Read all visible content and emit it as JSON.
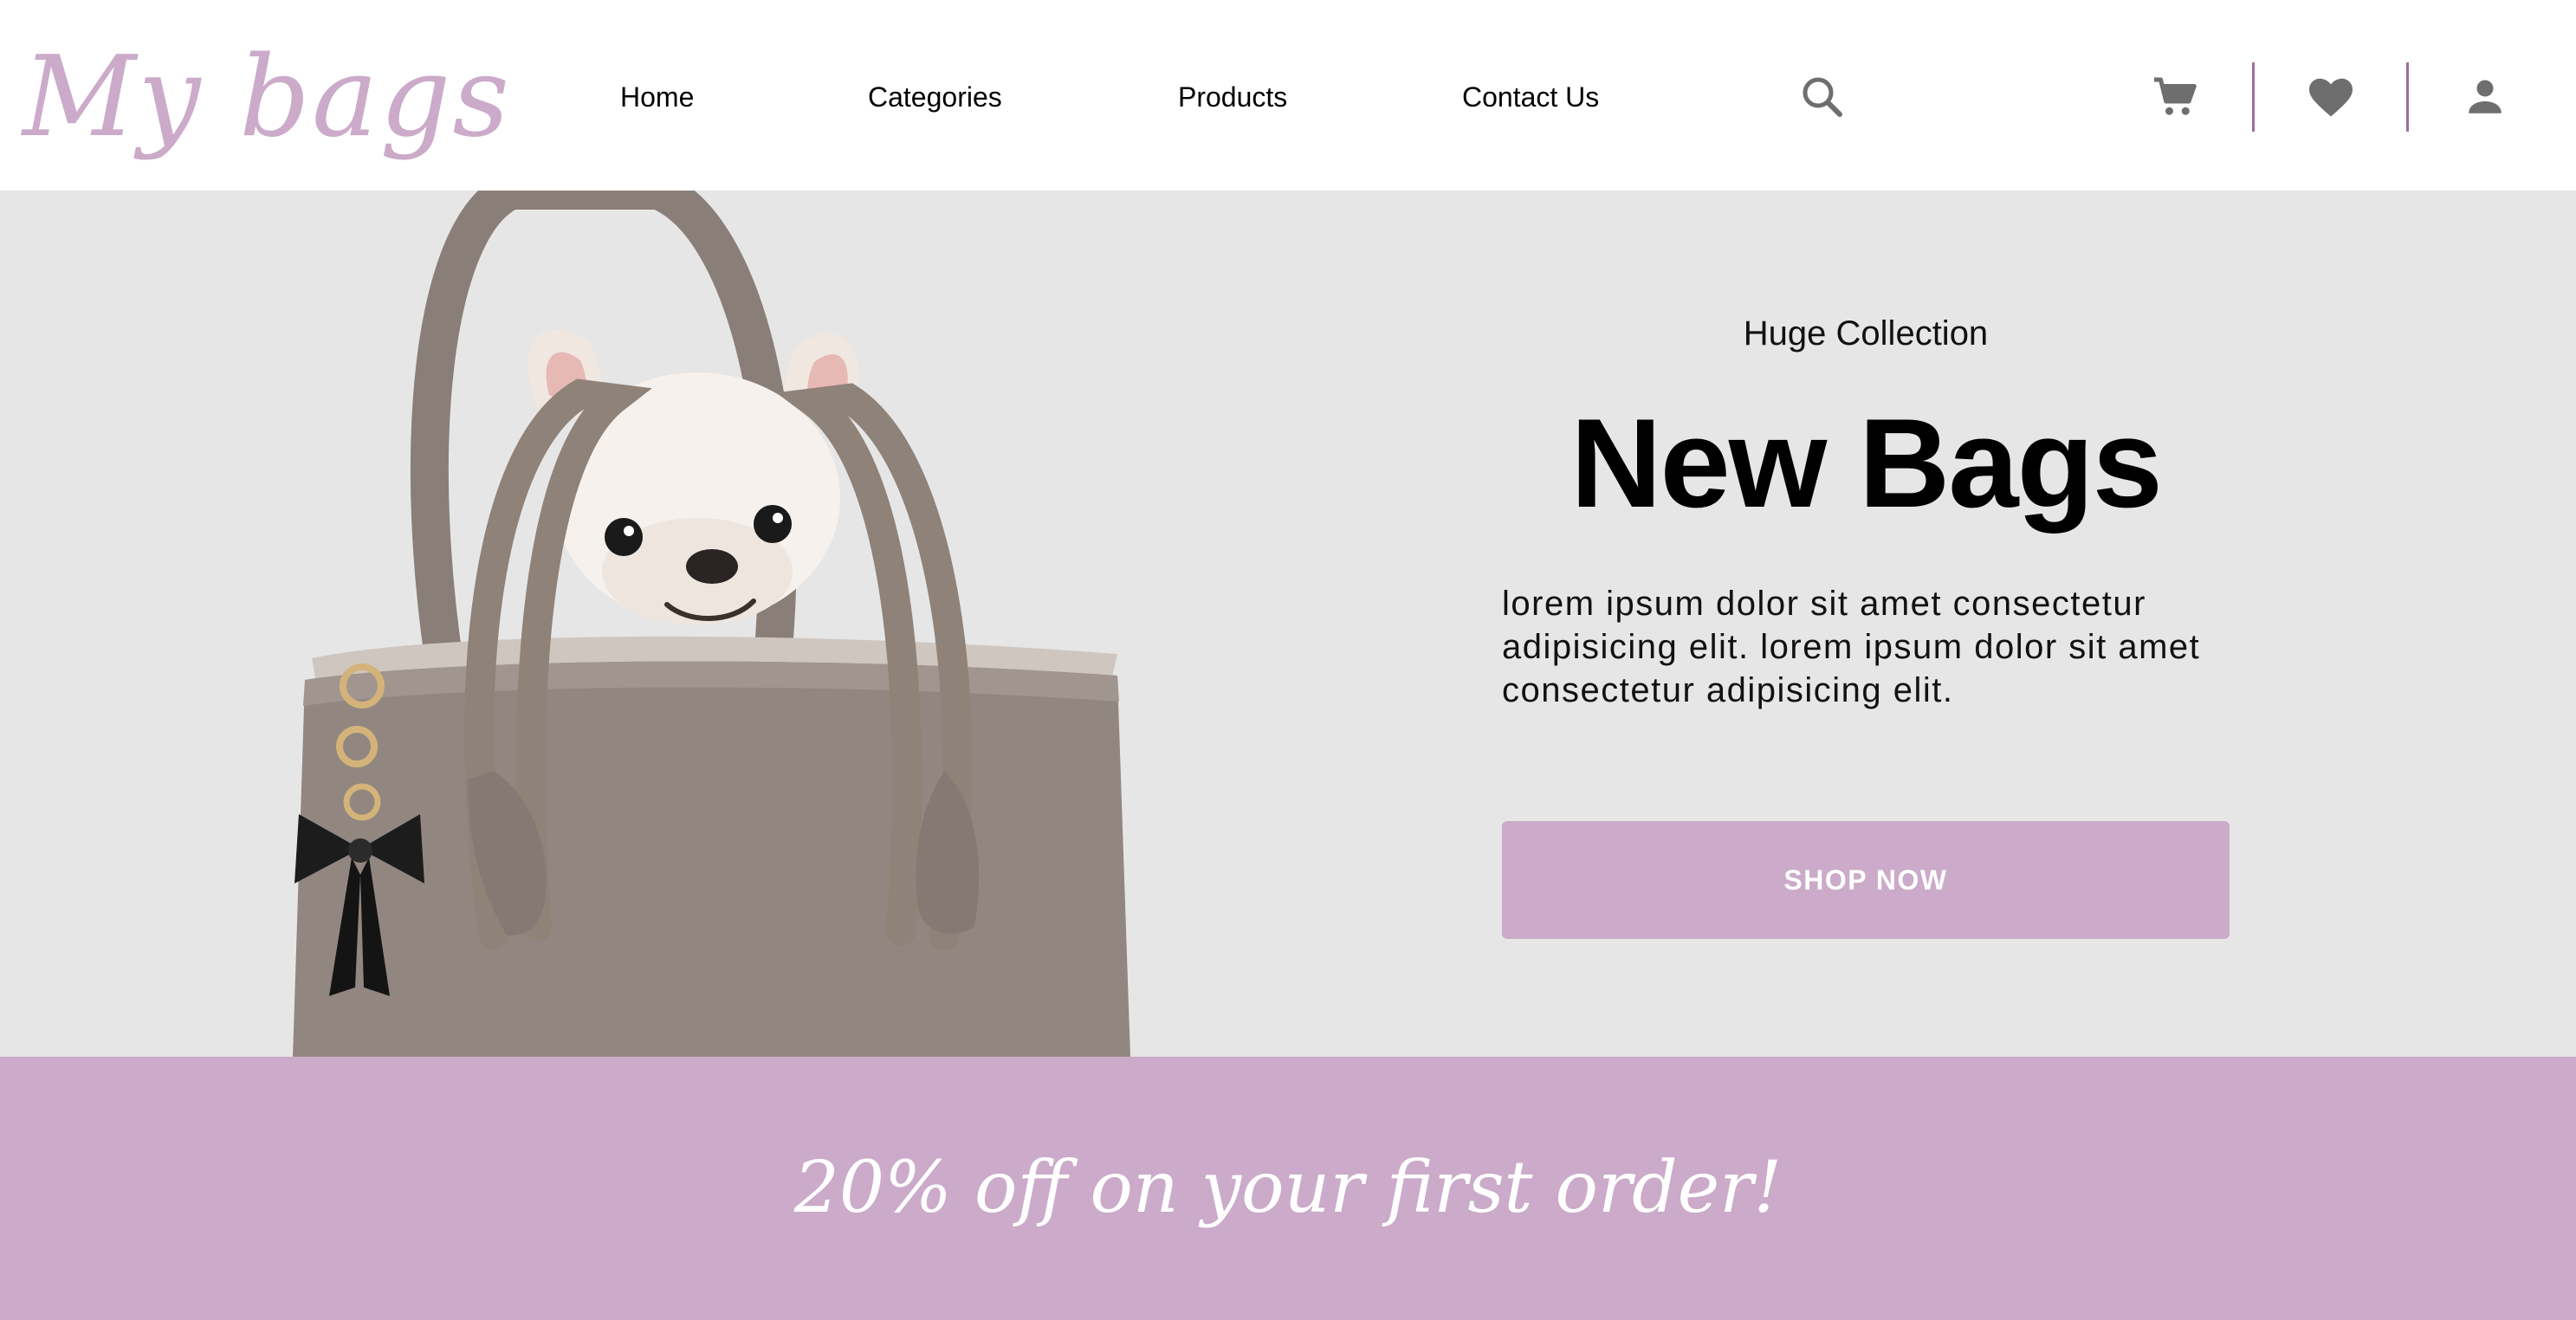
{
  "brand": {
    "logo_text": "My bags"
  },
  "nav": {
    "items": [
      {
        "label": "Home"
      },
      {
        "label": "Categories"
      },
      {
        "label": "Products"
      },
      {
        "label": "Contact Us"
      }
    ]
  },
  "header_icons": {
    "search": "search-icon",
    "cart": "cart-icon",
    "wishlist": "heart-icon",
    "account": "user-icon"
  },
  "hero": {
    "eyebrow": "Huge Collection",
    "title": "New Bags",
    "description": "lorem ipsum dolor sit amet consectetur adipisicing elit. lorem ipsum dolor sit amet consectetur adipisicing elit.",
    "cta_label": "SHOP NOW"
  },
  "promo": {
    "text": "20% off on your first order!"
  },
  "colors": {
    "accent": "#cbabc9",
    "divider": "#a06c9c",
    "hero_background": "#e6e6e6",
    "icon_gray": "#6e6e6e"
  }
}
